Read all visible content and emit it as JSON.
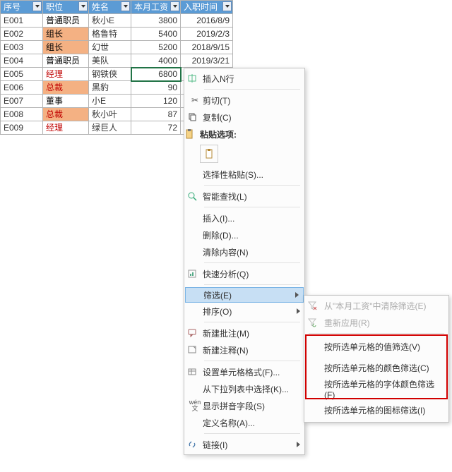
{
  "sheet": {
    "headers": [
      "序号",
      "职位",
      "姓名",
      "本月工资",
      "入职时间"
    ],
    "rows": [
      {
        "id": "E001",
        "pos": "普通职员",
        "pos_style": "",
        "name": "秋小E",
        "salary": "3800",
        "date": "2016/8/9"
      },
      {
        "id": "E002",
        "pos": "组长",
        "pos_style": "orange",
        "name": "格鲁特",
        "salary": "5400",
        "date": "2019/2/3"
      },
      {
        "id": "E003",
        "pos": "组长",
        "pos_style": "orange",
        "name": "幻世",
        "salary": "5200",
        "date": "2018/9/15"
      },
      {
        "id": "E004",
        "pos": "普通职员",
        "pos_style": "",
        "name": "美队",
        "salary": "4000",
        "date": "2019/3/21"
      },
      {
        "id": "E005",
        "pos": "经理",
        "pos_style": "red",
        "name": "钢铁侠",
        "salary": "6800",
        "date": ""
      },
      {
        "id": "E006",
        "pos": "总裁",
        "pos_style": "redorange",
        "name": "黑豹",
        "salary": "90",
        "date": ""
      },
      {
        "id": "E007",
        "pos": "董事",
        "pos_style": "",
        "name": "小E",
        "salary": "120",
        "date": ""
      },
      {
        "id": "E008",
        "pos": "总裁",
        "pos_style": "redorange",
        "name": "秋小叶",
        "salary": "87",
        "date": ""
      },
      {
        "id": "E009",
        "pos": "经理",
        "pos_style": "red",
        "name": "绿巨人",
        "salary": "72",
        "date": ""
      }
    ],
    "selected_cell": {
      "row": 4,
      "col": 3
    }
  },
  "menu": {
    "insert_rows": "插入N行",
    "cut": "剪切(T)",
    "copy": "复制(C)",
    "paste_section": "粘贴选项:",
    "paste_special": "选择性粘贴(S)...",
    "smart_lookup": "智能查找(L)",
    "insert": "插入(I)...",
    "delete": "删除(D)...",
    "clear": "清除内容(N)",
    "quick_analysis": "快速分析(Q)",
    "filter": "筛选(E)",
    "sort": "排序(O)",
    "new_comment": "新建批注(M)",
    "new_note": "新建注释(N)",
    "format_cells": "设置单元格格式(F)...",
    "dropdown_pick": "从下拉列表中选择(K)...",
    "show_pinyin": "显示拼音字段(S)",
    "define_name": "定义名称(A)...",
    "link": "链接(I)"
  },
  "submenu": {
    "clear_filter": "从\"本月工资\"中清除筛选(E)",
    "reapply": "重新应用(R)",
    "by_value": "按所选单元格的值筛选(V)",
    "by_color": "按所选单元格的颜色筛选(C)",
    "by_font_color": "按所选单元格的字体颜色筛选(F)",
    "by_icon": "按所选单元格的图标筛选(I)"
  }
}
